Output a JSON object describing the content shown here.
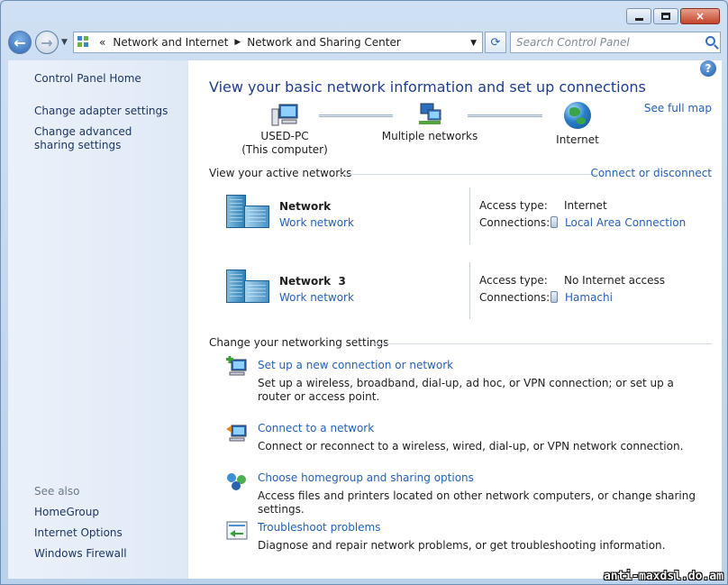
{
  "window": {
    "close_glyph": "×"
  },
  "address": {
    "chevron": "«",
    "crumbs": [
      "Network and Internet",
      "Network and Sharing Center"
    ],
    "dropdown_glyph": "▼",
    "refresh_glyph": "⟳"
  },
  "search": {
    "placeholder": "Search Control Panel"
  },
  "sidebar": {
    "home": "Control Panel Home",
    "links": [
      "Change adapter settings",
      "Change advanced sharing settings"
    ],
    "see_also_heading": "See also",
    "see_also": [
      "HomeGroup",
      "Internet Options",
      "Windows Firewall"
    ]
  },
  "main": {
    "help": "?",
    "title": "View your basic network information and set up connections",
    "see_full_map": "See full map",
    "map": {
      "computer": [
        "USED-PC",
        "(This computer)"
      ],
      "middle": "Multiple networks",
      "internet": "Internet"
    },
    "active_networks": {
      "heading": "View your active networks",
      "action": "Connect or disconnect",
      "access_type_label": "Access type:",
      "connections_label": "Connections:",
      "items": [
        {
          "name": "Network",
          "type": "Work network",
          "access": "Internet",
          "connection": "Local Area Connection"
        },
        {
          "name": "Network  3",
          "type": "Work network",
          "access": "No Internet access",
          "connection": "Hamachi"
        }
      ]
    },
    "settings": {
      "heading": "Change your networking settings",
      "tasks": [
        {
          "link": "Set up a new connection or network",
          "desc": "Set up a wireless, broadband, dial-up, ad hoc, or VPN connection; or set up a router or access point.",
          "icon": "new-connection-icon"
        },
        {
          "link": "Connect to a network",
          "desc": "Connect or reconnect to a wireless, wired, dial-up, or VPN network connection.",
          "icon": "connect-network-icon"
        },
        {
          "link": "Choose homegroup and sharing options",
          "desc": "Access files and printers located on other network computers, or change sharing settings.",
          "icon": "homegroup-icon"
        },
        {
          "link": "Troubleshoot problems",
          "desc": "Diagnose and repair network problems, or get troubleshooting information.",
          "icon": "troubleshoot-icon"
        }
      ]
    }
  },
  "watermark": "anti-maxdsl.do.am",
  "colors": {
    "link": "#2460b8",
    "title": "#1e3e8a",
    "sidebar_link": "#1e3660"
  }
}
